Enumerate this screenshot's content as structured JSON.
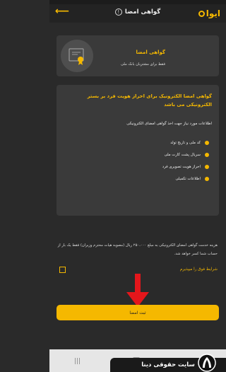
{
  "header": {
    "logo_text": "ایوا",
    "title": "گواهی امضا",
    "info_badge": "!",
    "back_icon": "arrow-left-icon"
  },
  "card1": {
    "title": "گواهی امضا",
    "subtitle": "فقط برای مشتریان بانک ملی",
    "icon": "certificate-icon"
  },
  "card2": {
    "title": "گواهی امضا الکترونیک برای احراز هویت فرد بر بستر الکترونیکی می باشد",
    "requirements_title": "اطلاعات مورد نیاز جهت اخذ گواهی امضای الکترونیکی",
    "requirements": [
      "کد ملی و تاریخ تولد",
      "سریال پشت کارت ملی",
      "احراز هویت تصویری فرد",
      "اطلاعات تکمیلی"
    ]
  },
  "fee_text": "هزینه خدمت گواهی امضای الکترونیکی به مبلغ ۲۵۰،۰۰۰ ریال (مصوبه هیات محترم وزیران) فقط یک بار از حساب شما کسر خواهد شد.",
  "terms": {
    "label": "شرایط فوق را میپذیرم",
    "checked": false
  },
  "submit_label": "ثبت امضا",
  "watermark_text": "سایت حقوقی دینا",
  "colors": {
    "accent": "#f5b800",
    "background": "#2a2a2a",
    "card": "#3a3a3a",
    "annotation_arrow": "#e4161b"
  }
}
